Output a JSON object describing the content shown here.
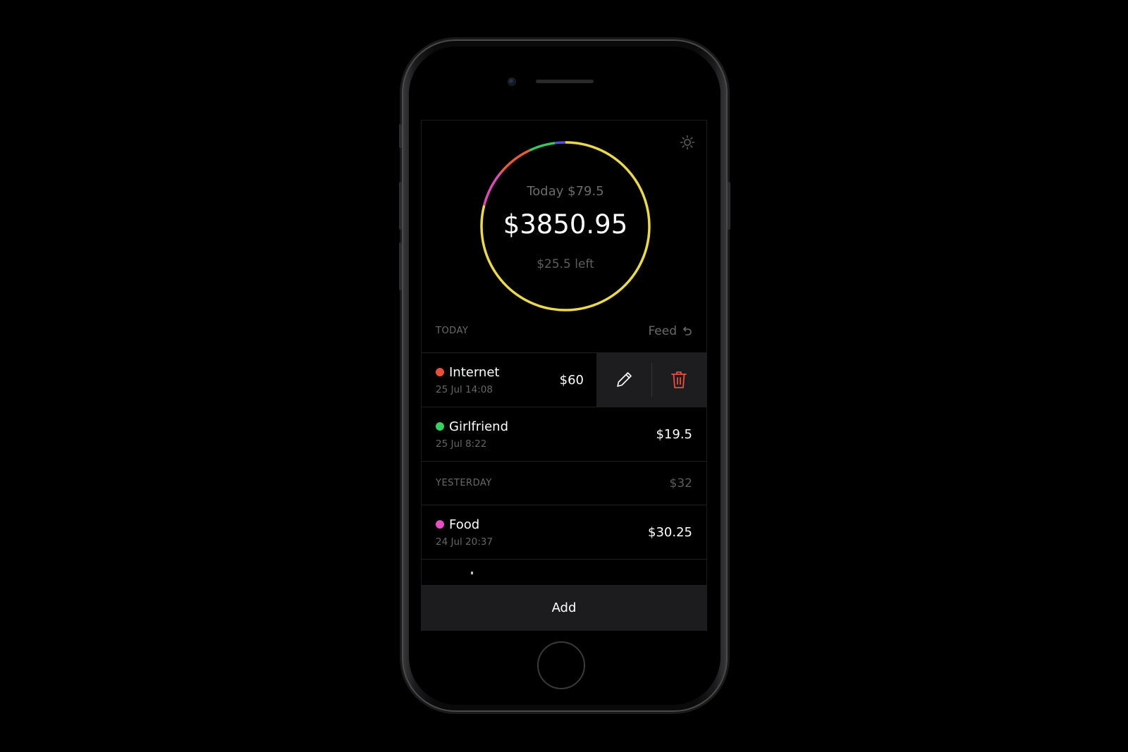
{
  "summary": {
    "today_label": "Today $79.5",
    "total": "$3850.95",
    "left_label": "$25.5 left"
  },
  "ring": {
    "segments": [
      {
        "color": "#ecd94b",
        "fraction": 0.79
      },
      {
        "color": "#e04ab8",
        "fraction": 0.07
      },
      {
        "color": "#e85a3e",
        "fraction": 0.07
      },
      {
        "color": "#39c760",
        "fraction": 0.05
      },
      {
        "color": "#5a4bd8",
        "fraction": 0.02
      }
    ]
  },
  "sections": {
    "today": {
      "title": "TODAY",
      "feed_label": "Feed"
    },
    "yesterday": {
      "title": "YESTERDAY",
      "total": "$32"
    }
  },
  "expenses": [
    {
      "name": "Internet",
      "date": "25 Jul 14:08",
      "amount": "$60",
      "color": "#e8503c"
    },
    {
      "name": "Girlfriend",
      "date": "25 Jul 8:22",
      "amount": "$19.5",
      "color": "#33d160"
    },
    {
      "name": "Food",
      "date": "24 Jul 20:37",
      "amount": "$30.25",
      "color": "#e64fc3"
    }
  ],
  "icons": {
    "settings": "gear-icon",
    "feed": "undo-arrow-icon",
    "edit": "pencil-icon",
    "delete": "trash-icon"
  },
  "colors": {
    "delete_icon": "#e8503c",
    "action_bg": "#1d1d1f",
    "add_bar_bg": "#1c1c1e"
  },
  "add_button": {
    "label": "Add"
  }
}
